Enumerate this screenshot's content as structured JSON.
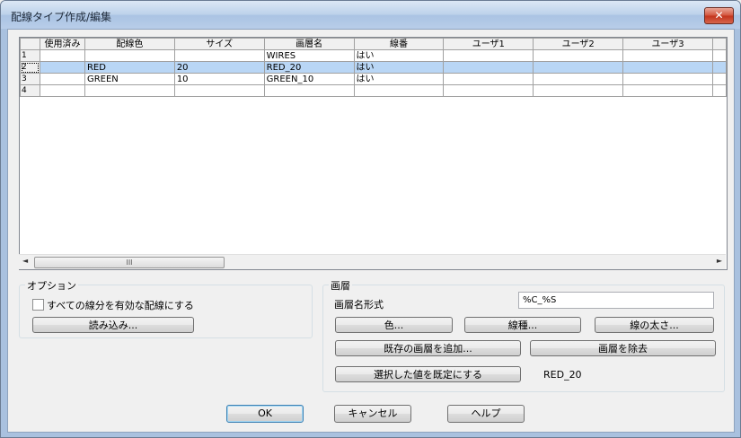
{
  "window": {
    "title": "配線タイプ作成/編集",
    "close_label": "✕"
  },
  "grid": {
    "columns": [
      "使用済み",
      "配線色",
      "サイズ",
      "画層名",
      "線番",
      "ユーザ1",
      "ユーザ2",
      "ユーザ3"
    ],
    "rows": [
      {
        "num": "1",
        "cells": [
          "",
          "",
          "",
          "WIRES",
          "はい",
          "",
          "",
          ""
        ],
        "selected": false
      },
      {
        "num": "2",
        "cells": [
          "",
          "RED",
          "20",
          "RED_20",
          "はい",
          "",
          "",
          ""
        ],
        "selected": true
      },
      {
        "num": "3",
        "cells": [
          "",
          "GREEN",
          "10",
          "GREEN_10",
          "はい",
          "",
          "",
          ""
        ],
        "selected": false
      },
      {
        "num": "4",
        "cells": [
          "",
          "",
          "",
          "",
          "",
          "",
          "",
          ""
        ],
        "selected": false
      }
    ],
    "scroll_thumb_glyph": "III"
  },
  "options": {
    "title": "オプション",
    "checkbox_label": "すべての線分を有効な配線にする",
    "checkbox_checked": false,
    "import_button": "読み込み..."
  },
  "layer": {
    "title": "画層",
    "format_label": "画層名形式",
    "format_value": "%C_%S",
    "color_button": "色...",
    "linetype_button": "線種...",
    "lineweight_button": "線の太さ...",
    "add_existing_button": "既存の画層を追加...",
    "remove_button": "画層を除去",
    "set_default_button": "選択した値を既定にする",
    "default_value": "RED_20"
  },
  "footer": {
    "ok": "OK",
    "cancel": "キャンセル",
    "help": "ヘルプ"
  }
}
